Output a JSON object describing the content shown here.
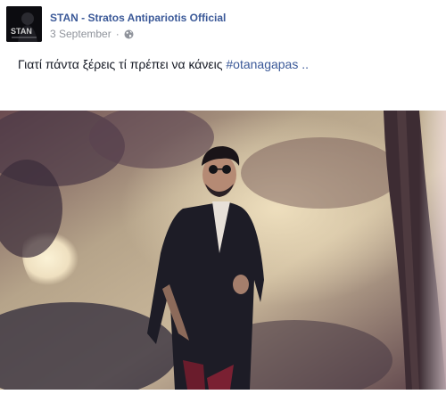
{
  "post": {
    "author": "STAN - Stratos Antipariotis Official",
    "date": "3 September",
    "separator": "·",
    "privacy_icon": "globe-icon",
    "text": "Γιατί πάντα ξέρεις τί πρέπει να κάνεις",
    "hashtag": "#otanagapas",
    "text_suffix": " ..",
    "avatar_text": "STAN"
  },
  "colors": {
    "link": "#3b5998",
    "text": "#141823",
    "meta": "#90949c"
  }
}
